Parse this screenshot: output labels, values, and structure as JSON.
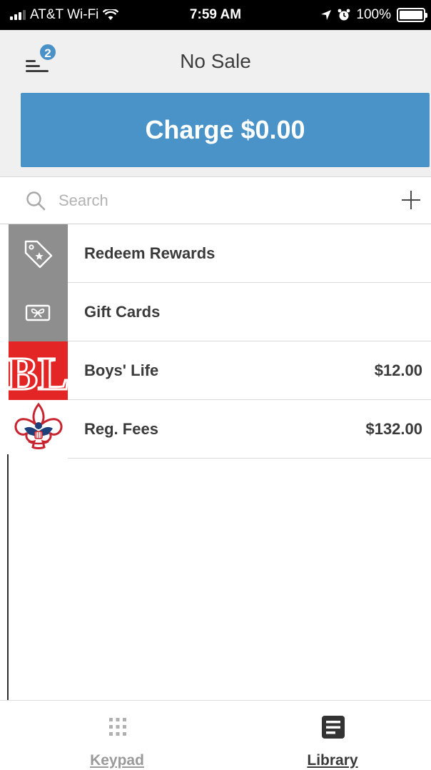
{
  "status_bar": {
    "carrier": "AT&T Wi-Fi",
    "time": "7:59 AM",
    "battery": "100%"
  },
  "header": {
    "title": "No Sale",
    "menu_badge": "2",
    "charge_label": "Charge $0.00"
  },
  "search": {
    "placeholder": "Search",
    "value": ""
  },
  "items": [
    {
      "label": "Redeem Rewards",
      "price": "",
      "icon": "tag-star-icon"
    },
    {
      "label": "Gift Cards",
      "price": "",
      "icon": "gift-card-icon"
    },
    {
      "label": "Boys' Life",
      "price": "$12.00",
      "icon": "bl-logo"
    },
    {
      "label": "Reg. Fees",
      "price": "$132.00",
      "icon": "bsa-fleur-de-lis-logo"
    }
  ],
  "tabs": [
    {
      "label": "Keypad",
      "icon": "keypad-icon",
      "active": false
    },
    {
      "label": "Library",
      "icon": "library-icon",
      "active": true
    }
  ],
  "colors": {
    "accent": "#4a93c8",
    "header_bg": "#f0f0f0",
    "thumb_gray": "#8e8e8e",
    "bl_red": "#e42526"
  }
}
